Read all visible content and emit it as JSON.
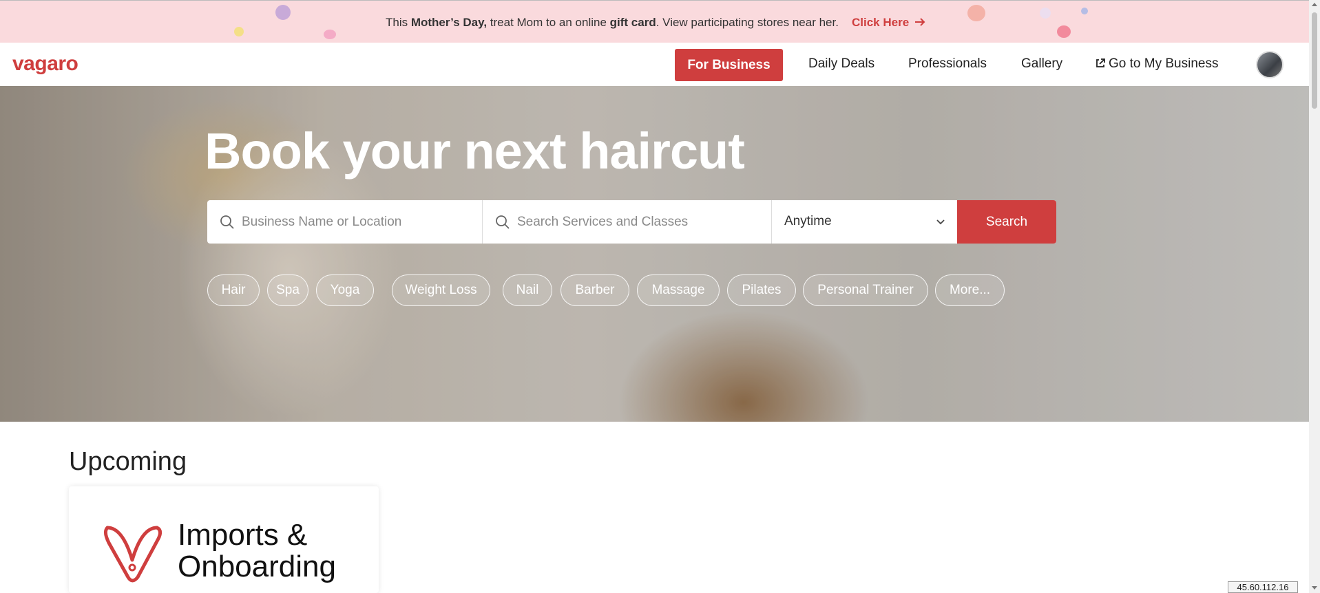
{
  "promo": {
    "text_1": "This ",
    "text_bold_1": "Mother’s Day,",
    "text_2": " treat Mom to an online ",
    "text_bold_2": "gift card",
    "text_3": ". View participating stores near her.",
    "link_label": "Click Here",
    "link_icon": "arrow-right-icon"
  },
  "header": {
    "logo": "vagaro",
    "nav": {
      "for_business": "For Business",
      "daily_deals": "Daily Deals",
      "professionals": "Professionals",
      "gallery": "Gallery",
      "go_to_my_business": "Go to My Business"
    },
    "avatar_icon": "user-avatar-icon"
  },
  "hero": {
    "title": "Book your next haircut",
    "search": {
      "location_placeholder": "Business Name or Location",
      "service_placeholder": "Search Services and Classes",
      "time_value": "Anytime",
      "button": "Search"
    },
    "chips": [
      "Hair",
      "Spa",
      "Yoga",
      "Weight Loss",
      "Nail",
      "Barber",
      "Massage",
      "Pilates",
      "Personal Trainer",
      "More..."
    ]
  },
  "upcoming": {
    "title": "Upcoming",
    "card_title": "Imports & Onboarding"
  },
  "ip_badge": "45.60.112.16",
  "colors": {
    "brand_red": "#cf3e3e",
    "promo_bg": "#fadadd"
  }
}
